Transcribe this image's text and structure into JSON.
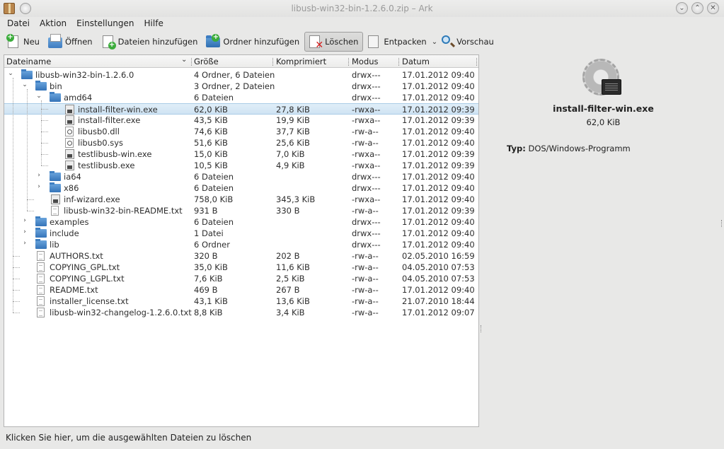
{
  "window": {
    "title": "libusb-win32-bin-1.2.6.0.zip – Ark"
  },
  "menu": [
    {
      "label": "Datei",
      "accel": "D"
    },
    {
      "label": "Aktion",
      "accel": "A"
    },
    {
      "label": "Einstellungen",
      "accel": "E"
    },
    {
      "label": "Hilfe",
      "accel": "H"
    }
  ],
  "toolbar": {
    "new": "Neu",
    "open": "Öffnen",
    "add_files": "Dateien hinzufügen",
    "add_folder": "Ordner hinzufügen",
    "delete": "Löschen",
    "extract": "Entpacken",
    "preview": "Vorschau"
  },
  "columns": {
    "name": "Dateiname",
    "size": "Größe",
    "compressed": "Komprimiert",
    "mode": "Modus",
    "date": "Datum"
  },
  "rows": [
    {
      "name": "libusb-win32-bin-1.2.6.0",
      "size": "4 Ordner, 6 Dateien",
      "comp": "",
      "mode": "drwx---",
      "date": "17.01.2012 09:40",
      "type": "folder",
      "depth": 0,
      "exp": "open"
    },
    {
      "name": "bin",
      "size": "3 Ordner, 2 Dateien",
      "comp": "",
      "mode": "drwx---",
      "date": "17.01.2012 09:40",
      "type": "folder",
      "depth": 1,
      "exp": "open"
    },
    {
      "name": "amd64",
      "size": "6 Dateien",
      "comp": "",
      "mode": "drwx---",
      "date": "17.01.2012 09:40",
      "type": "folder",
      "depth": 2,
      "exp": "open"
    },
    {
      "name": "install-filter-win.exe",
      "size": "62,0 KiB",
      "comp": "27,8 KiB",
      "mode": "-rwxa--",
      "date": "17.01.2012 09:39",
      "type": "exe",
      "depth": 3,
      "exp": "",
      "selected": true
    },
    {
      "name": "install-filter.exe",
      "size": "43,5 KiB",
      "comp": "19,9 KiB",
      "mode": "-rwxa--",
      "date": "17.01.2012 09:39",
      "type": "exe",
      "depth": 3,
      "exp": ""
    },
    {
      "name": "libusb0.dll",
      "size": "74,6 KiB",
      "comp": "37,7 KiB",
      "mode": "-rw-a--",
      "date": "17.01.2012 09:40",
      "type": "gear",
      "depth": 3,
      "exp": ""
    },
    {
      "name": "libusb0.sys",
      "size": "51,6 KiB",
      "comp": "25,6 KiB",
      "mode": "-rw-a--",
      "date": "17.01.2012 09:40",
      "type": "gear",
      "depth": 3,
      "exp": ""
    },
    {
      "name": "testlibusb-win.exe",
      "size": "15,0 KiB",
      "comp": "7,0 KiB",
      "mode": "-rwxa--",
      "date": "17.01.2012 09:39",
      "type": "exe",
      "depth": 3,
      "exp": ""
    },
    {
      "name": "testlibusb.exe",
      "size": "10,5 KiB",
      "comp": "4,9 KiB",
      "mode": "-rwxa--",
      "date": "17.01.2012 09:39",
      "type": "exe",
      "depth": 3,
      "exp": ""
    },
    {
      "name": "ia64",
      "size": "6 Dateien",
      "comp": "",
      "mode": "drwx---",
      "date": "17.01.2012 09:40",
      "type": "folder",
      "depth": 2,
      "exp": "closed"
    },
    {
      "name": "x86",
      "size": "6 Dateien",
      "comp": "",
      "mode": "drwx---",
      "date": "17.01.2012 09:40",
      "type": "folder",
      "depth": 2,
      "exp": "closed"
    },
    {
      "name": "inf-wizard.exe",
      "size": "758,0 KiB",
      "comp": "345,3 KiB",
      "mode": "-rwxa--",
      "date": "17.01.2012 09:40",
      "type": "exe",
      "depth": 2,
      "exp": ""
    },
    {
      "name": "libusb-win32-bin-README.txt",
      "size": "931 B",
      "comp": "330 B",
      "mode": "-rw-a--",
      "date": "17.01.2012 09:39",
      "type": "file",
      "depth": 2,
      "exp": ""
    },
    {
      "name": "examples",
      "size": "6 Dateien",
      "comp": "",
      "mode": "drwx---",
      "date": "17.01.2012 09:40",
      "type": "folder",
      "depth": 1,
      "exp": "closed"
    },
    {
      "name": "include",
      "size": "1 Datei",
      "comp": "",
      "mode": "drwx---",
      "date": "17.01.2012 09:40",
      "type": "folder",
      "depth": 1,
      "exp": "closed"
    },
    {
      "name": "lib",
      "size": "6 Ordner",
      "comp": "",
      "mode": "drwx---",
      "date": "17.01.2012 09:40",
      "type": "folder",
      "depth": 1,
      "exp": "closed"
    },
    {
      "name": "AUTHORS.txt",
      "size": "320 B",
      "comp": "202 B",
      "mode": "-rw-a--",
      "date": "02.05.2010 16:59",
      "type": "file",
      "depth": 1,
      "exp": ""
    },
    {
      "name": "COPYING_GPL.txt",
      "size": "35,0 KiB",
      "comp": "11,6 KiB",
      "mode": "-rw-a--",
      "date": "04.05.2010 07:53",
      "type": "file",
      "depth": 1,
      "exp": ""
    },
    {
      "name": "COPYING_LGPL.txt",
      "size": "7,6 KiB",
      "comp": "2,5 KiB",
      "mode": "-rw-a--",
      "date": "04.05.2010 07:53",
      "type": "file",
      "depth": 1,
      "exp": ""
    },
    {
      "name": "README.txt",
      "size": "469 B",
      "comp": "267 B",
      "mode": "-rw-a--",
      "date": "17.01.2012 09:40",
      "type": "file",
      "depth": 1,
      "exp": ""
    },
    {
      "name": "installer_license.txt",
      "size": "43,1 KiB",
      "comp": "13,6 KiB",
      "mode": "-rw-a--",
      "date": "21.07.2010 18:44",
      "type": "file",
      "depth": 1,
      "exp": ""
    },
    {
      "name": "libusb-win32-changelog-1.2.6.0.txt",
      "size": "8,8 KiB",
      "comp": "3,4 KiB",
      "mode": "-rw-a--",
      "date": "17.01.2012 09:07",
      "type": "file",
      "depth": 1,
      "exp": ""
    }
  ],
  "info": {
    "name": "install-filter-win.exe",
    "size": "62,0 KiB",
    "type_label": "Typ:",
    "type_value": "DOS/Windows-Programm"
  },
  "status": "Klicken Sie hier, um die ausgewählten Dateien zu löschen",
  "colors": {
    "selection": "#cfe3f3",
    "folder": "#3574b8"
  }
}
